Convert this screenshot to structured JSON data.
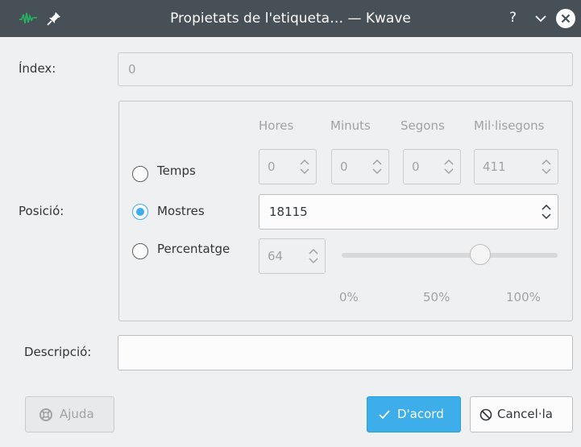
{
  "window": {
    "title": "Propietats de l'etiqueta… — Kwave",
    "help_label": "?"
  },
  "index": {
    "label": "Índex:",
    "value": "0"
  },
  "position": {
    "label": "Posició:",
    "columns": [
      "Hores",
      "Minuts",
      "Segons",
      "Mil·lisegons"
    ],
    "time": {
      "label": "Temps",
      "checked": false,
      "hours": "0",
      "minutes": "0",
      "seconds": "0",
      "milliseconds": "411"
    },
    "samples": {
      "label": "Mostres",
      "checked": true,
      "value": "18115"
    },
    "percentage": {
      "label": "Percentatge",
      "checked": false,
      "value": "64",
      "slider_level": 0.64,
      "ticks": [
        "0%",
        "50%",
        "100%"
      ]
    }
  },
  "description": {
    "label": "Descripció:",
    "value": ""
  },
  "buttons": {
    "help": "Ajuda",
    "ok": "D'acord",
    "cancel": "Cancel·la"
  },
  "colors": {
    "titlebar": "#475057",
    "accent": "#3daee9",
    "background": "#eff0f1"
  },
  "icons": [
    "kwave-app-icon",
    "pin-icon",
    "minimize-icon",
    "close-icon",
    "spin-arrows-icon",
    "help-lifebuoy-icon",
    "check-icon",
    "cancel-icon"
  ]
}
